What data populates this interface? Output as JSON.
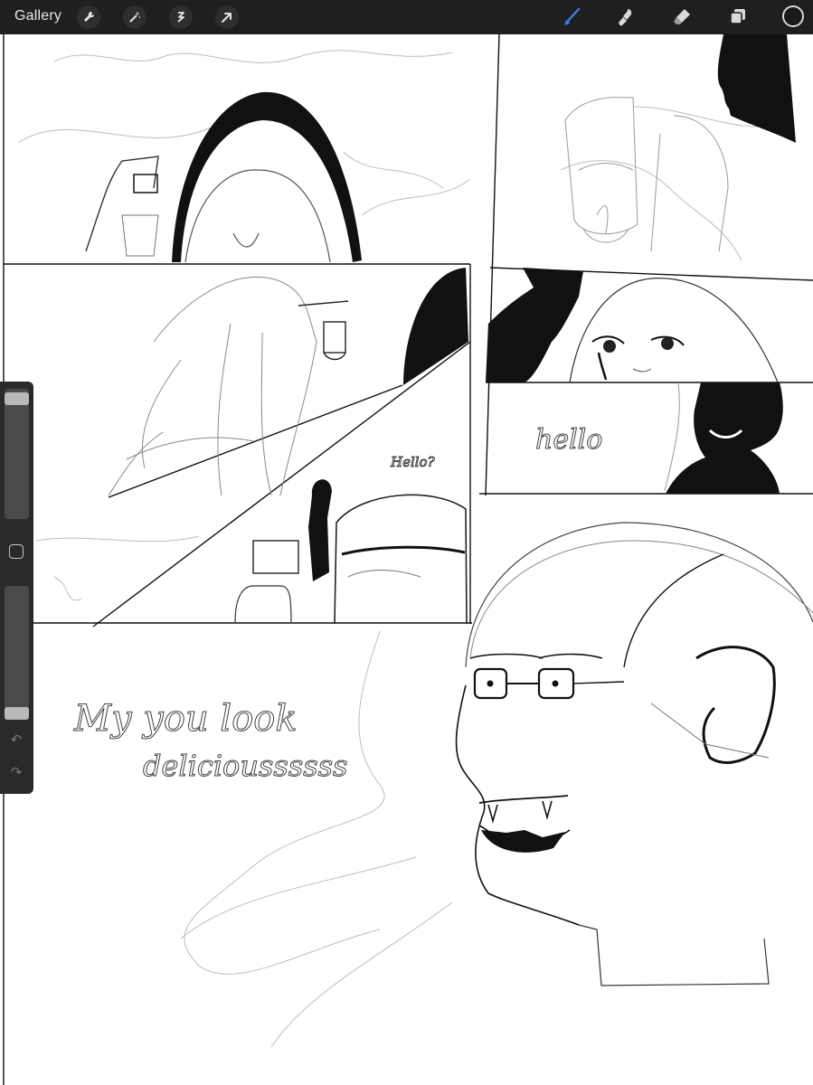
{
  "toolbar": {
    "gallery_label": "Gallery",
    "left_tools": [
      "wrench-icon",
      "magic-wand-icon",
      "selection-icon",
      "transform-arrow-icon"
    ],
    "right_tools": [
      "brush-icon",
      "smudge-icon",
      "eraser-icon",
      "layers-icon"
    ],
    "active_tool": "brush-icon",
    "current_color": "#1a1a1a",
    "active_tool_color": "#2f80ed"
  },
  "sidebar": {
    "brush_size_level": 0.0,
    "opacity_level": 0.0,
    "undo_icon": "undo-icon",
    "redo_icon": "redo-icon"
  },
  "canvas": {
    "sketch_texts": {
      "hello_question": "Hello?",
      "hello": "hello",
      "line1": "My you look",
      "line2": "delicioussssss"
    }
  }
}
